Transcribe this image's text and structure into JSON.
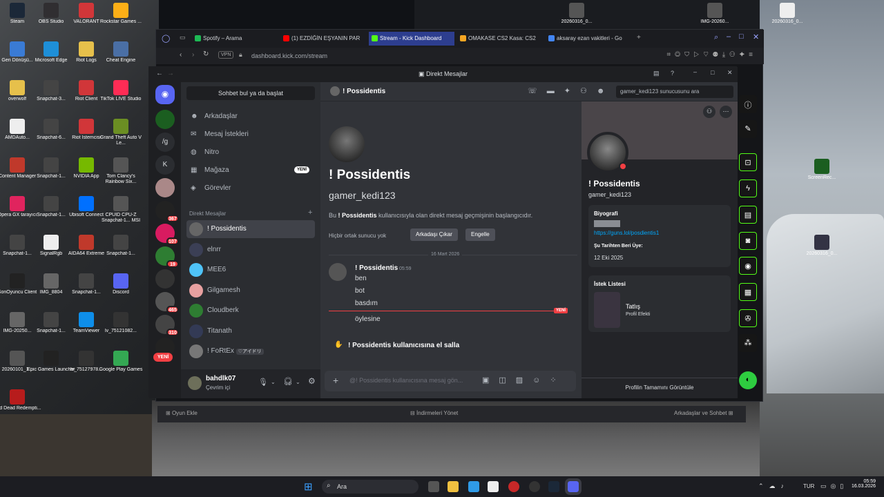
{
  "desktop": {
    "icons": [
      {
        "label": "Steam",
        "color": "#1b2838"
      },
      {
        "label": "OBS Studio",
        "color": "#302e31"
      },
      {
        "label": "VALORANT",
        "color": "#d13639"
      },
      {
        "label": "Rockstar Games ...",
        "color": "#fcaf17"
      },
      {
        "label": "Geri Dönüşü...",
        "color": "#3a7bd5"
      },
      {
        "label": "Microsoft Edge",
        "color": "#1e8fd8"
      },
      {
        "label": "Riot Logs",
        "color": "#e6c04b"
      },
      {
        "label": "Cheat Engine",
        "color": "#4a6fa5"
      },
      {
        "label": "overwolf",
        "color": "#e6c04b"
      },
      {
        "label": "Snapchat-3...",
        "color": "#444"
      },
      {
        "label": "Riot Client",
        "color": "#d13639"
      },
      {
        "label": "TikTok LIVE Studio",
        "color": "#fe2c55"
      },
      {
        "label": "AMDAuto...",
        "color": "#eee"
      },
      {
        "label": "Snapchat-6...",
        "color": "#444"
      },
      {
        "label": "Riot İstemcisi",
        "color": "#d13639"
      },
      {
        "label": "Grand Theft Auto V Le...",
        "color": "#6b8e23"
      },
      {
        "label": "Content Manager",
        "color": "#c0392b"
      },
      {
        "label": "Snapchat-1...",
        "color": "#444"
      },
      {
        "label": "NVIDIA App",
        "color": "#76b900"
      },
      {
        "label": "Tom Clancy's Rainbow Six...",
        "color": "#555"
      },
      {
        "label": "Opera GX tarayıcı",
        "color": "#e0245e"
      },
      {
        "label": "Snapchat-1...",
        "color": "#444"
      },
      {
        "label": "Ubisoft Connect",
        "color": "#0070ff"
      },
      {
        "label": "CPUID CPU-Z Snapchat-1... MSI",
        "color": "#555"
      },
      {
        "label": "Snapchat-1...",
        "color": "#444"
      },
      {
        "label": "SignalRgb",
        "color": "#eee"
      },
      {
        "label": "AIDA64 Extreme",
        "color": "#c0392b"
      },
      {
        "label": "Snapchat-1...",
        "color": "#444"
      },
      {
        "label": "SonOyuncu Client",
        "color": "#222"
      },
      {
        "label": "IMG_8804",
        "color": "#666"
      },
      {
        "label": "Snapchat-1...",
        "color": "#444"
      },
      {
        "label": "Discord",
        "color": "#5865f2"
      },
      {
        "label": "IMG-20250...",
        "color": "#666"
      },
      {
        "label": "Snapchat-1...",
        "color": "#444"
      },
      {
        "label": "TeamViewer",
        "color": "#0e8ee9"
      },
      {
        "label": "lv_75121082...",
        "color": "#333"
      },
      {
        "label": "20260101_1...",
        "color": "#555"
      },
      {
        "label": "Epic Games Launcher",
        "color": "#222"
      },
      {
        "label": "lv_75127978...",
        "color": "#333"
      },
      {
        "label": "Google Play Games",
        "color": "#34a853"
      },
      {
        "label": "Red Dead Redempti...",
        "color": "#b71c1c"
      }
    ],
    "top_icons": [
      {
        "label": "20260316_0...",
        "color": "#555"
      },
      {
        "label": "IMG-20260...",
        "color": "#555"
      },
      {
        "label": "20260316_0...",
        "color": "#eee"
      }
    ],
    "right_icons": [
      {
        "label": "ScreenRec...",
        "color": "#1b5e20"
      },
      {
        "label": "20260316_0...",
        "color": "#334"
      }
    ]
  },
  "browser": {
    "tabs": [
      {
        "label": "Spotify – Arama",
        "color": "#1db954"
      },
      {
        "label": "(1) EZDİĞİN EŞYANIN PAR",
        "color": "#ff0000"
      },
      {
        "label": "Stream - Kick Dashboard",
        "color": "#53fc18"
      },
      {
        "label": "OMAKASE CS2 Kasa: CS2",
        "color": "#f5a623"
      },
      {
        "label": "aksaray ezan vakitleri - Go",
        "color": "#4285f4"
      }
    ],
    "vpn": "VPN",
    "url": "dashboard.kick.com/stream"
  },
  "discord": {
    "window_title": "Direkt Mesajlar",
    "search_placeholder": "Sohbet bul ya da başlat",
    "nav": {
      "friends": "Arkadaşlar",
      "requests": "Mesaj İstekleri",
      "nitro": "Nitro",
      "shop": "Mağaza",
      "shop_badge": "YENİ",
      "quests": "Görevler"
    },
    "dm_header": "Direkt Mesajlar",
    "dms": [
      {
        "name": "! Possidentis",
        "color": "#666"
      },
      {
        "name": "elnrr",
        "color": "#3b3f55"
      },
      {
        "name": "MEE6",
        "color": "#4fc3f7"
      },
      {
        "name": "Gilgamesh",
        "color": "#e8a0a0"
      },
      {
        "name": "Cloudberk",
        "color": "#2e7d32"
      },
      {
        "name": "Titanath",
        "color": "#333a55"
      },
      {
        "name": "! FoRtEx",
        "tag": "♡アイドリ",
        "color": "#777"
      }
    ],
    "servers": [
      {
        "label": "",
        "badge": "",
        "color": "#1b5e20"
      },
      {
        "label": "/g",
        "badge": "",
        "color": "#2b2d31"
      },
      {
        "label": "K",
        "badge": "",
        "color": "#2b2d31"
      },
      {
        "label": "",
        "badge": "",
        "color": "#a88"
      },
      {
        "label": "",
        "badge": "367",
        "color": "#222"
      },
      {
        "label": "",
        "badge": "107",
        "color": "#d81b60"
      },
      {
        "label": "",
        "badge": "19",
        "color": "#2e7d32"
      },
      {
        "label": "",
        "badge": "",
        "color": "#333"
      },
      {
        "label": "",
        "badge": "465",
        "color": "#555"
      },
      {
        "label": "",
        "badge": "310",
        "color": "#444"
      },
      {
        "label": "",
        "badge": "",
        "color": "#222"
      }
    ],
    "servers_new": "YENİ",
    "user": {
      "name": "bahdlk07",
      "status": "Çevrim içi"
    },
    "chat": {
      "header_name": "! Possidentis",
      "search_placeholder": "gamer_kedi123 sunucusunu ara",
      "intro_name": "! Possidentis",
      "intro_username": "gamer_kedi123",
      "intro_text_pre": "Bu ",
      "intro_text_bold": "! Possidentis",
      "intro_text_post": " kullanıcısıyla olan direkt mesaj geçmişinin başlangıcıdır.",
      "no_common": "Hiçbir ortak sunucu yok",
      "remove_friend": "Arkadaşı Çıkar",
      "block": "Engelle",
      "date_divider": "16 Mart 2026",
      "msg_author": "! Possidentis",
      "msg_time": "05:59",
      "lines": [
        "ben",
        "bot",
        "basdım"
      ],
      "new_label": "YENİ",
      "after_new": "öylesine",
      "wave": "! Possidentis kullanıcısına el salla",
      "composer_placeholder": "@! Possidentis kullanıcısına mesaj gön..."
    },
    "profile": {
      "name": "! Possidentis",
      "username": "gamer_kedi123",
      "bio_title": "Biyografi",
      "bio_link": "https://guns.lol/posdientis1",
      "member_since_title": "Şu Tarihten Beri Üye:",
      "member_since": "12 Eki 2025",
      "wishlist_title": "İstek Listesi",
      "wish_item": "Tatlış",
      "wish_sub": "Profil Efekti",
      "view_full": "Profilin Tamamını Görüntüle"
    }
  },
  "under_bar": {
    "add_game": "Oyun Ekle",
    "downloads": "İndirmeleri Yönet",
    "friends_chat": "Arkadaşlar ve Sohbet"
  },
  "taskbar": {
    "search": "Ara",
    "lang": "TUR",
    "time": "05:59",
    "date": "16.03.2026"
  }
}
